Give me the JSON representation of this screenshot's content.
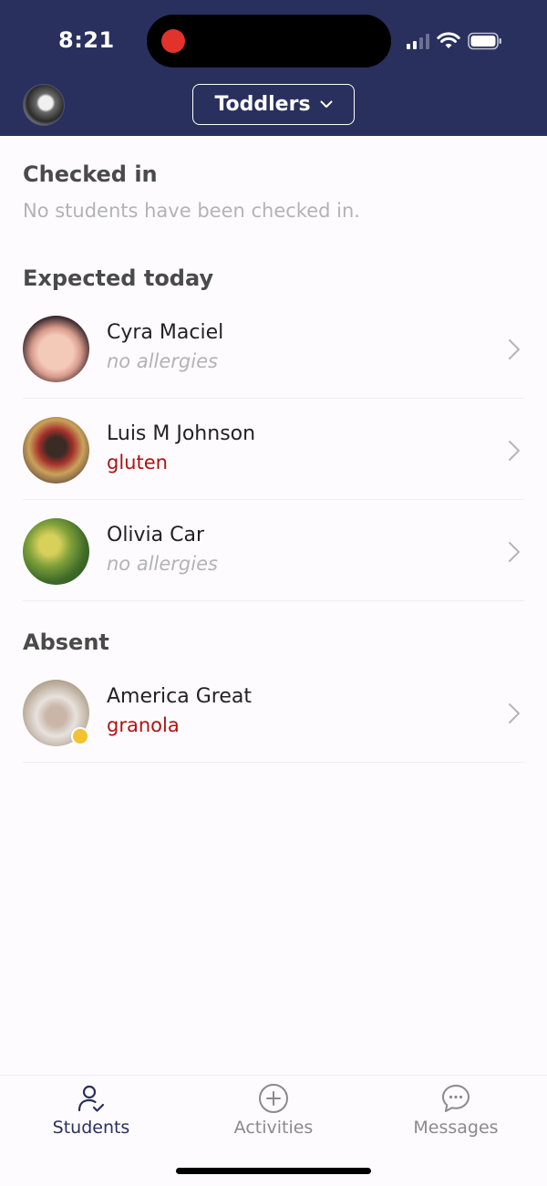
{
  "status_bar": {
    "time": "8:21"
  },
  "header": {
    "class_selector": "Toddlers",
    "colors": {
      "header_bg": "#29305e",
      "record_dot": "#e2322c"
    }
  },
  "sections": {
    "checked_in": {
      "title": "Checked in",
      "empty_message": "No students have been checked in."
    },
    "expected_today": {
      "title": "Expected today",
      "students": [
        {
          "name": "Cyra Maciel",
          "allergy": "no allergies"
        },
        {
          "name": "Luis M Johnson",
          "allergy": "gluten"
        },
        {
          "name": "Olivia Car",
          "allergy": "no allergies"
        }
      ]
    },
    "absent": {
      "title": "Absent",
      "students": [
        {
          "name": "America Great",
          "allergy": "granola"
        }
      ]
    }
  },
  "tabs": [
    {
      "label": "Students",
      "icon": "student-icon",
      "active": true
    },
    {
      "label": "Activities",
      "icon": "add-circle-icon",
      "active": false
    },
    {
      "label": "Messages",
      "icon": "chat-icon",
      "active": false
    }
  ],
  "colors": {
    "allergy_text": "#b01212",
    "absent_status_dot": "#f2c230",
    "active_tab": "#29305e"
  }
}
